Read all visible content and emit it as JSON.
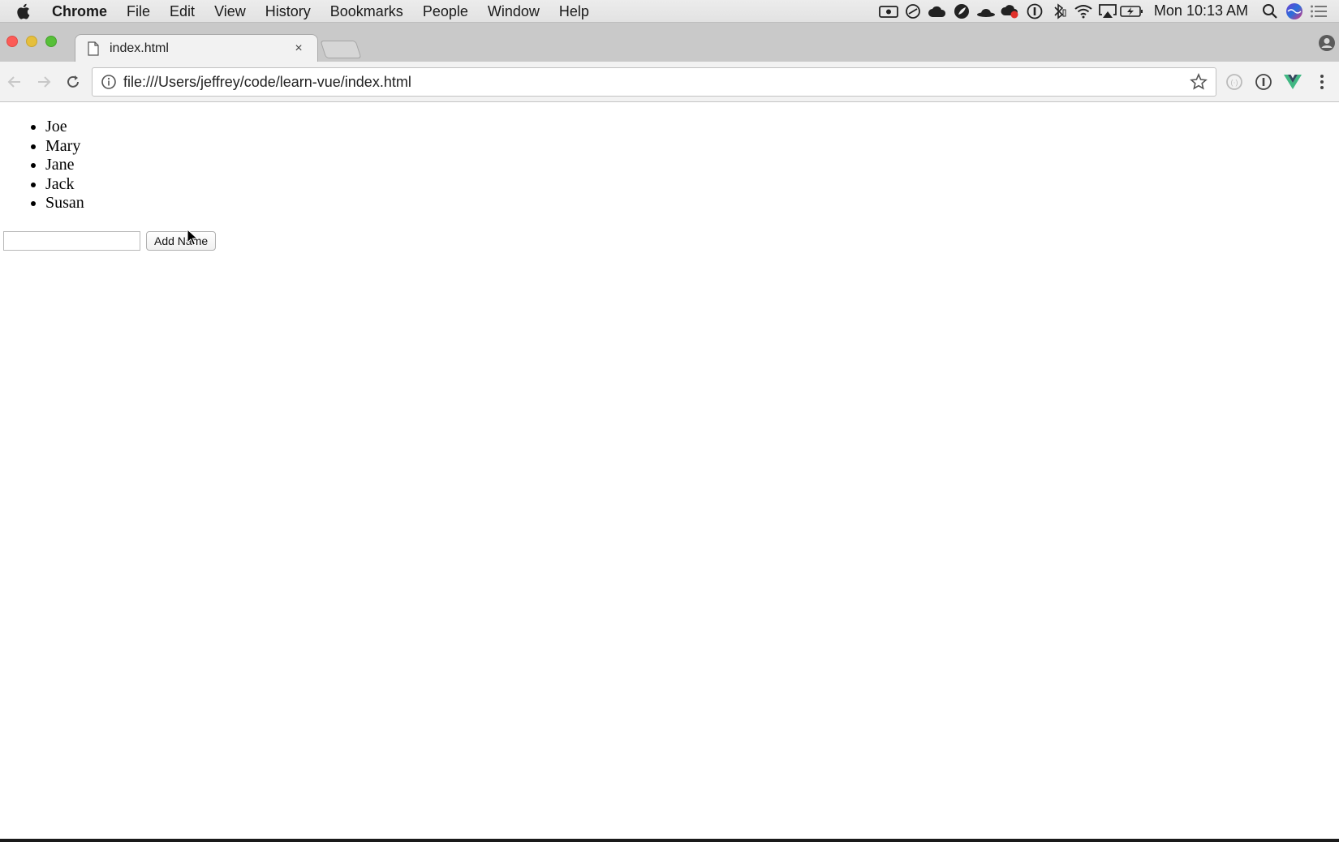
{
  "menubar": {
    "app_name": "Chrome",
    "items": [
      "File",
      "Edit",
      "View",
      "History",
      "Bookmarks",
      "People",
      "Window",
      "Help"
    ],
    "clock": "Mon 10:13 AM"
  },
  "tab": {
    "title": "index.html",
    "close_glyph": "×"
  },
  "toolbar": {
    "url": "file:///Users/jeffrey/code/learn-vue/index.html"
  },
  "page": {
    "names": [
      "Joe",
      "Mary",
      "Jane",
      "Jack",
      "Susan"
    ],
    "input_value": "",
    "add_button_label": "Add Name"
  },
  "colors": {
    "close": "#fc5b57",
    "minimize": "#e5bf3c",
    "maximize": "#57c038",
    "vue_green": "#41b883"
  }
}
